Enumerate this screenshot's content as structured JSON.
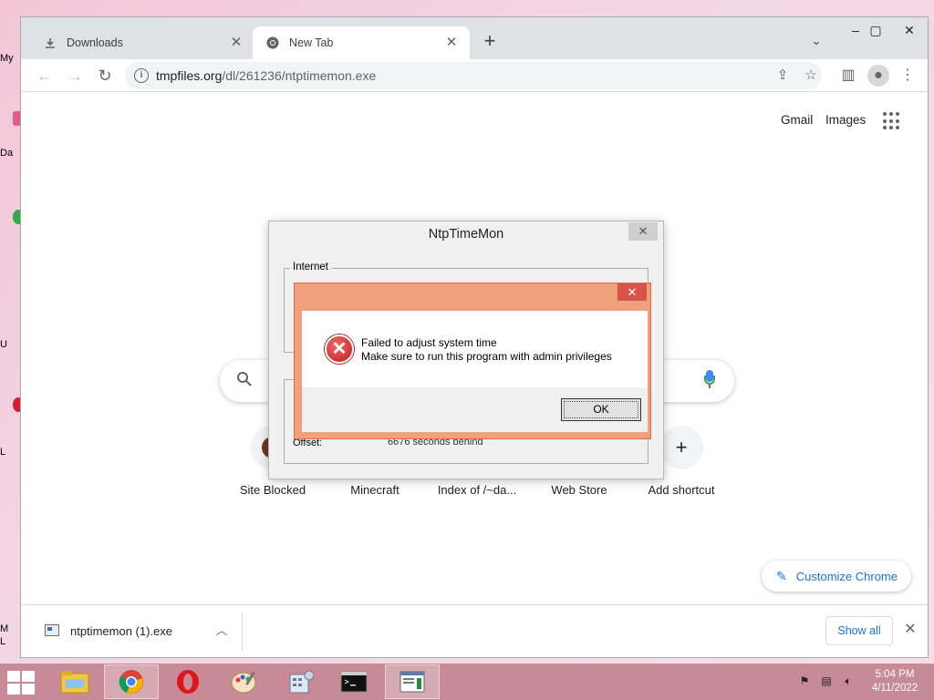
{
  "desktop": {
    "icon_labels": [
      "My",
      "Da",
      "",
      "",
      "U",
      "",
      "L",
      "M",
      "L"
    ]
  },
  "tabs": [
    {
      "title": "Downloads",
      "icon": "download-icon",
      "active": false
    },
    {
      "title": "New Tab",
      "icon": "chrome-icon",
      "active": true
    }
  ],
  "toolbar": {
    "url_host": "tmpfiles.org",
    "url_path": "/dl/261236/ntptimemon.exe"
  },
  "newtab": {
    "gmail_label": "Gmail",
    "images_label": "Images",
    "shortcuts": [
      {
        "label": "Site Blocked"
      },
      {
        "label": "Minecraft"
      },
      {
        "label": "Index of /~da..."
      },
      {
        "label": "Web Store"
      },
      {
        "label": "Add shortcut"
      }
    ],
    "customize_label": "Customize Chrome"
  },
  "download_bar": {
    "file_name": "ntptimemon (1).exe",
    "show_all_label": "Show all"
  },
  "ntp_window": {
    "title": "NtpTimeMon",
    "group_internet": "Internet",
    "offset_label": "Offset:",
    "offset_value": "6676 seconds behind"
  },
  "error_dialog": {
    "line1": "Failed to adjust system time",
    "line2": "Make sure to run this program with admin privileges",
    "ok_label": "OK"
  },
  "taskbar": {
    "apps": [
      "file-explorer",
      "chrome",
      "opera",
      "paint",
      "calculator-settings",
      "command-prompt",
      "ntptimemon"
    ],
    "time": "5:04 PM",
    "date": "4/11/2022"
  },
  "colors": {
    "accent_blue": "#1a73e8",
    "error_frame": "#f0a07b",
    "taskbar": "#c78a96"
  }
}
